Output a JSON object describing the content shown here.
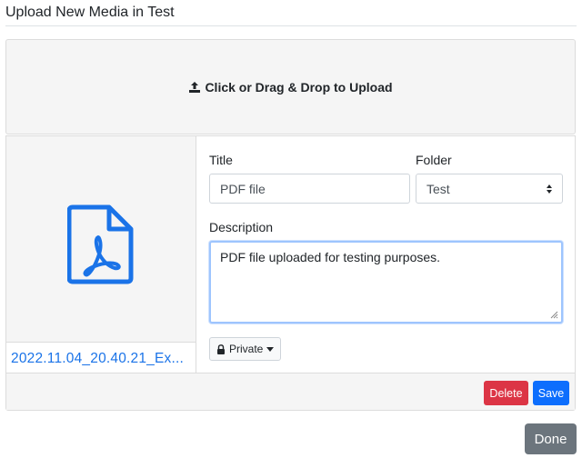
{
  "modal": {
    "title": "Upload New Media in Test"
  },
  "dropzone": {
    "label": "Click or Drag & Drop to Upload",
    "icon": "upload-icon"
  },
  "media": {
    "file_name": "2022.11.04_20.40.21_Ex...",
    "file_icon": "pdf-file-icon",
    "title_label": "Title",
    "title_value": "PDF file",
    "folder_label": "Folder",
    "folder_value": "Test",
    "description_label": "Description",
    "description_value": "PDF file uploaded for testing purposes.",
    "privacy_label": "Private",
    "delete_label": "Delete",
    "save_label": "Save"
  },
  "footer": {
    "done_label": "Done"
  },
  "colors": {
    "accent": "#0d6efd",
    "danger": "#dc3545",
    "secondary": "#6c757d",
    "link": "#1a73e8",
    "pdf_icon": "#1a73e8"
  }
}
